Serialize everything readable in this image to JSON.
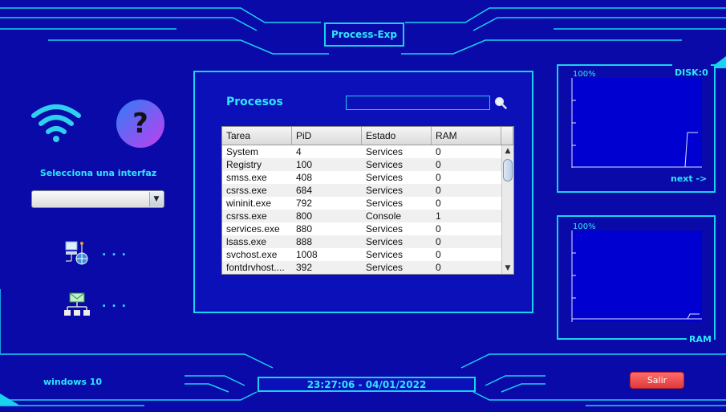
{
  "app": {
    "title": "Process-Exp"
  },
  "left": {
    "interface_label": "Selecciona una interfaz",
    "interface_select_value": "",
    "dots_1": "...",
    "dots_2": "...",
    "icons": [
      "wifi-icon",
      "help-icon",
      "network-globe-icon",
      "mail-network-icon"
    ]
  },
  "process_panel": {
    "title": "Procesos",
    "search": {
      "value": "",
      "placeholder": ""
    },
    "columns": [
      "Tarea",
      "PiD",
      "Estado",
      "RAM"
    ],
    "rows": [
      [
        "System",
        "4",
        "Services",
        "0"
      ],
      [
        "Registry",
        "100",
        "Services",
        "0"
      ],
      [
        "smss.exe",
        "408",
        "Services",
        "0"
      ],
      [
        "csrss.exe",
        "684",
        "Services",
        "0"
      ],
      [
        "wininit.exe",
        "792",
        "Services",
        "0"
      ],
      [
        "csrss.exe",
        "800",
        "Console",
        "1"
      ],
      [
        "services.exe",
        "880",
        "Services",
        "0"
      ],
      [
        "lsass.exe",
        "888",
        "Services",
        "0"
      ],
      [
        "svchost.exe",
        "1008",
        "Services",
        "0"
      ],
      [
        "fontdrvhost....",
        "392",
        "Services",
        "0"
      ]
    ]
  },
  "graphs": {
    "disk": {
      "label": "DISK:0",
      "max_label": "100%",
      "next_label": "next ->"
    },
    "ram": {
      "label": "RAM",
      "max_label": "100%"
    }
  },
  "footer": {
    "os_label": "windows 10",
    "clock": "23:27:06 - 04/01/2022",
    "exit_label": "Salir"
  },
  "colors": {
    "background": "#0a0aa8",
    "accent": "#19d2f0",
    "text_accent": "#2ee6ff",
    "exit": "#f04848"
  }
}
